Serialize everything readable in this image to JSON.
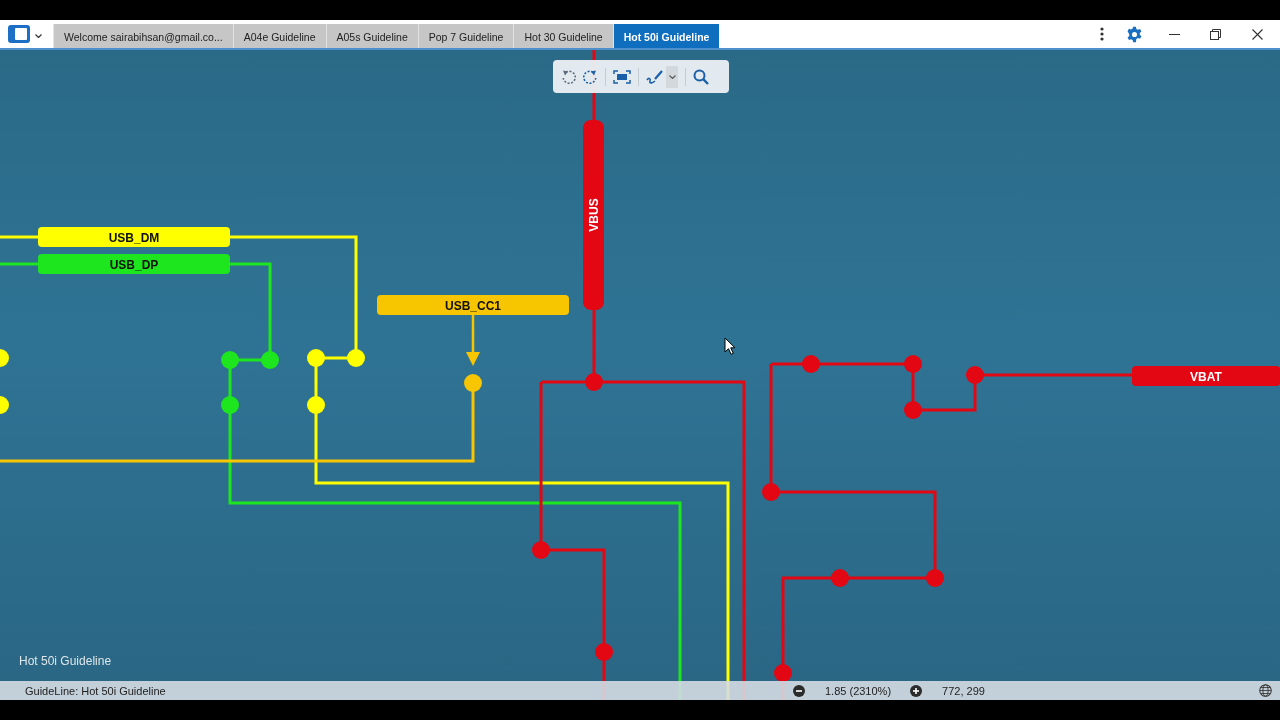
{
  "app_bar": {
    "tabs": [
      {
        "label": "Welcome sairabihsan@gmail.co...",
        "selected": false
      },
      {
        "label": "A04e Guideline",
        "selected": false
      },
      {
        "label": "A05s Guideline",
        "selected": false
      },
      {
        "label": "Pop 7 Guideline",
        "selected": false
      },
      {
        "label": "Hot 30 Guideline",
        "selected": false
      },
      {
        "label": "Hot 50i Guideline",
        "selected": true
      }
    ]
  },
  "canvas": {
    "nets": [
      {
        "label": "USB_DM",
        "color": "#ffff00"
      },
      {
        "label": "USB_DP",
        "color": "#1ee61e"
      },
      {
        "label": "USB_CC1",
        "color": "#f7c600"
      },
      {
        "label": "VBUS",
        "color": "#e30613"
      },
      {
        "label": "VBAT",
        "color": "#e30613"
      }
    ],
    "caption": "Hot 50i Guideline"
  },
  "status_bar": {
    "guideline": "GuideLine: Hot 50i Guideline",
    "zoom": "1.85 (2310%)",
    "coordinates": "772, 299"
  }
}
